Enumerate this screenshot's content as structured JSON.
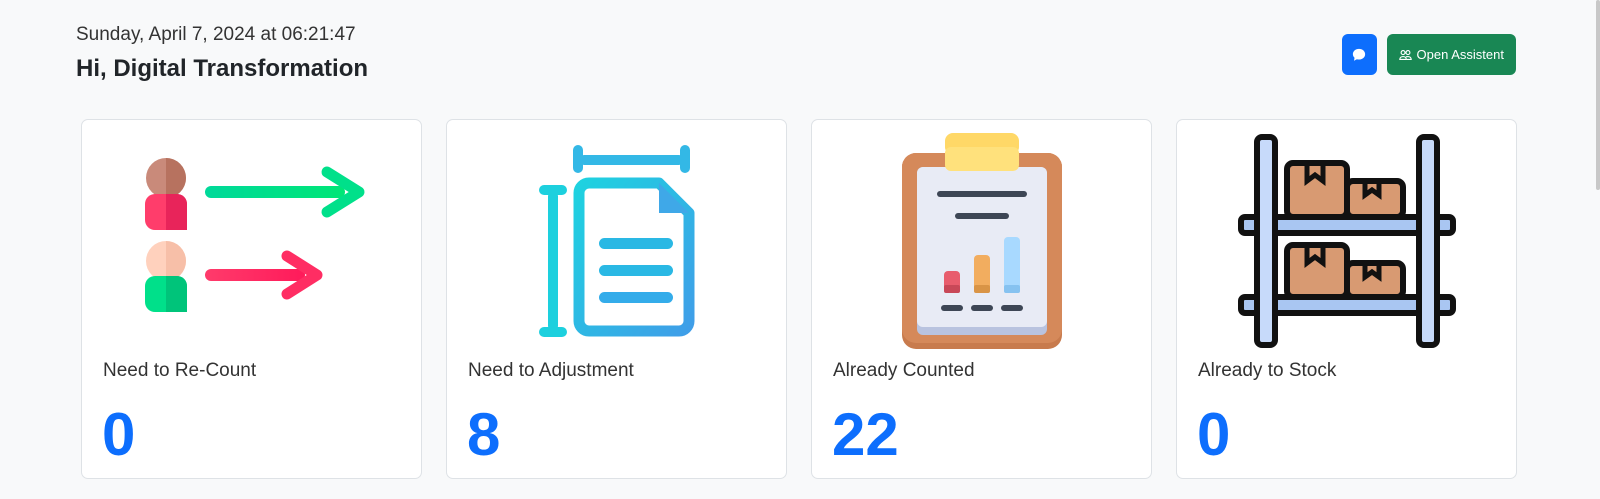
{
  "header": {
    "datetime": "Sunday, April 7, 2024 at 06:21:47",
    "greeting": "Hi, Digital Transformation"
  },
  "actions": {
    "chat_icon": "chat-icon",
    "assistant_label": "Open Assistent",
    "assistant_icon": "people-icon"
  },
  "colors": {
    "primary": "#0d6efd",
    "success": "#198754",
    "background": "#f8f9fa"
  },
  "cards": [
    {
      "label": "Need to Re-Count",
      "value": "0",
      "icon": "recount-people-arrows-icon"
    },
    {
      "label": "Need to Adjustment",
      "value": "8",
      "icon": "document-adjustment-icon"
    },
    {
      "label": "Already Counted",
      "value": "22",
      "icon": "clipboard-chart-icon"
    },
    {
      "label": "Already to Stock",
      "value": "0",
      "icon": "shelf-boxes-icon"
    }
  ]
}
